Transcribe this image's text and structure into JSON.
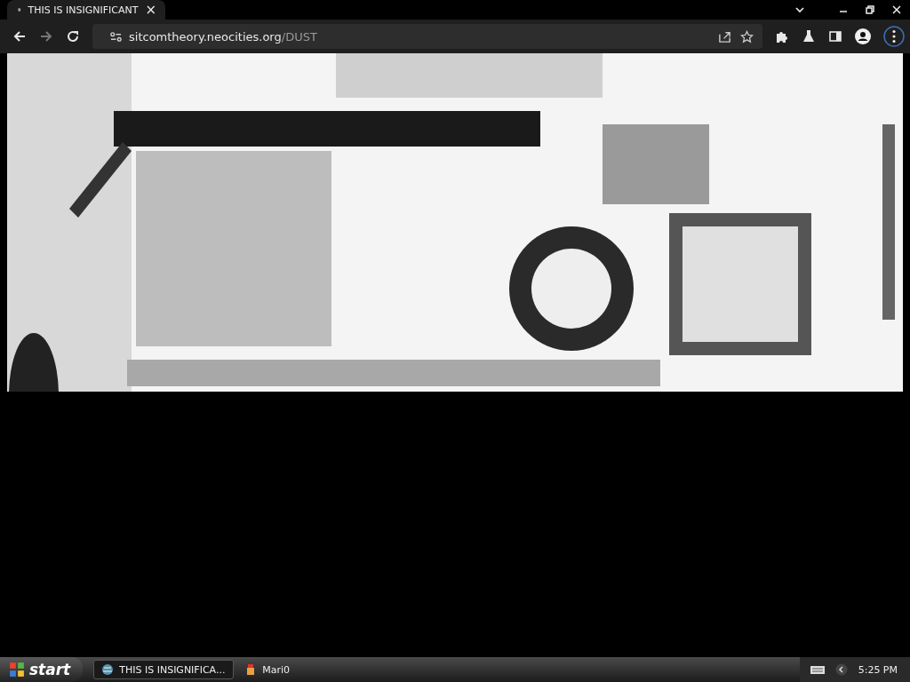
{
  "browser": {
    "tabs": [
      {
        "title": "THIS IS INSIGNIFICANT",
        "close": "×",
        "selected": true
      }
    ],
    "address": {
      "host": "sitcomtheory.neocities.org",
      "path": "/DUST"
    }
  },
  "taskbar": {
    "start": "start",
    "tasks": [
      {
        "label": "THIS IS INSIGNIFICA...",
        "kind": "browser",
        "selected": true
      },
      {
        "label": "Mari0",
        "kind": "game",
        "selected": false
      }
    ],
    "clock": "5:25 PM"
  }
}
